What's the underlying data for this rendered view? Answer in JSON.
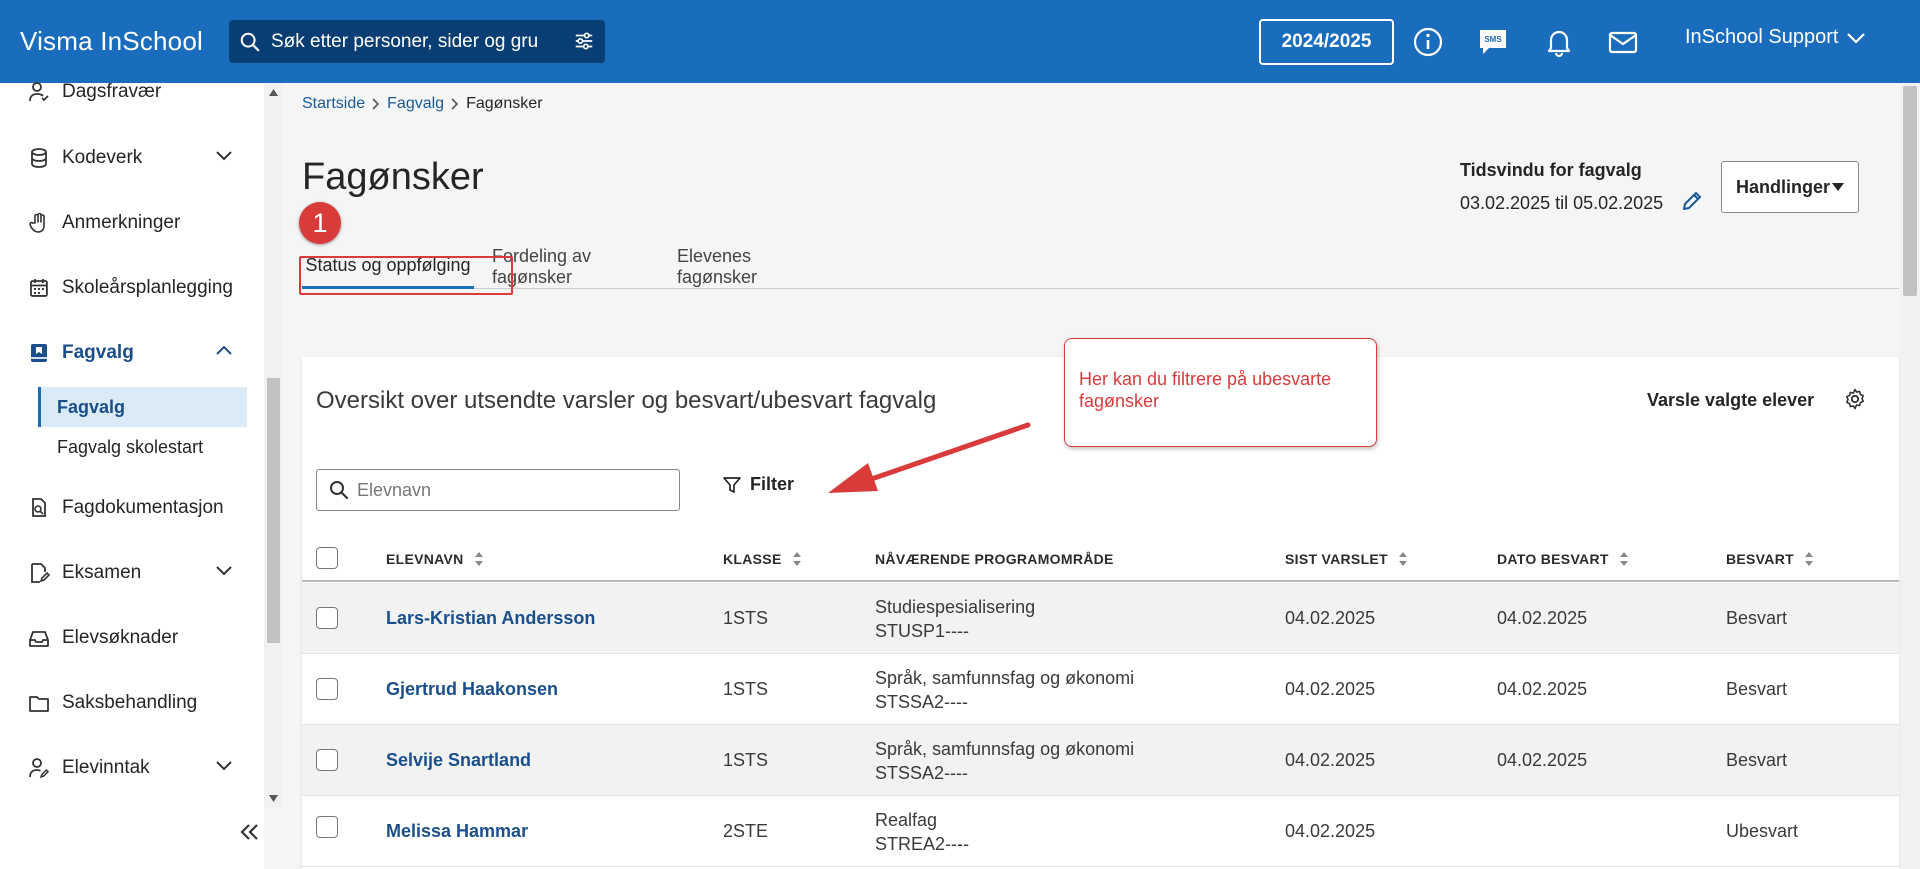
{
  "app": {
    "brand": "Visma InSchool"
  },
  "search": {
    "placeholder": "Søk etter personer, sider og gru"
  },
  "topbar": {
    "school_year": "2024/2025",
    "user": "InSchool Support"
  },
  "sidebar": {
    "items": [
      {
        "label": "Dagsfravær",
        "icon": "person-check-icon"
      },
      {
        "label": "Kodeverk",
        "icon": "database-icon",
        "expandable": true
      },
      {
        "label": "Anmerkninger",
        "icon": "hand-icon"
      },
      {
        "label": "Skoleårsplanlegging",
        "icon": "calendar-icon"
      },
      {
        "label": "Fagvalg",
        "icon": "book-bookmark-icon",
        "expanded": true,
        "active": true
      },
      {
        "label": "Fagdokumentasjon",
        "icon": "file-search-icon"
      },
      {
        "label": "Eksamen",
        "icon": "edit-document-icon",
        "expandable": true
      },
      {
        "label": "Elevsøknader",
        "icon": "inbox-icon"
      },
      {
        "label": "Saksbehandling",
        "icon": "folder-icon"
      },
      {
        "label": "Elevinntak",
        "icon": "person-edit-icon",
        "expandable": true
      }
    ],
    "subitems": [
      {
        "label": "Fagvalg",
        "active": true
      },
      {
        "label": "Fagvalg skolestart",
        "active": false
      }
    ]
  },
  "breadcrumb": {
    "items": [
      "Startside",
      "Fagvalg"
    ],
    "current": "Fagønsker"
  },
  "page": {
    "title": "Fagønsker",
    "step_badge": "1",
    "time_window_label": "Tidsvindu for fagvalg",
    "time_window_value": "03.02.2025 til 05.02.2025",
    "actions_label": "Handlinger"
  },
  "tabs": [
    {
      "label": "Status og oppfølging",
      "active": true
    },
    {
      "label": "Fordeling av fagønsker",
      "active": false
    },
    {
      "label": "Elevenes fagønsker",
      "active": false
    }
  ],
  "card": {
    "title": "Oversikt over utsendte varsler og besvart/ubesvart fagvalg",
    "notify_label": "Varsle valgte elever",
    "search_placeholder": "Elevnavn",
    "filter_label": "Filter"
  },
  "callout": {
    "text": "Her kan du filtrere på ubesvarte fagønsker"
  },
  "table": {
    "headers": [
      "ELEVNAVN",
      "KLASSE",
      "NÅVÆRENDE PROGRAMOMRÅDE",
      "SIST VARSLET",
      "DATO BESVART",
      "BESVART"
    ],
    "rows": [
      {
        "name": "Lars-Kristian Andersson",
        "class": "1STS",
        "program": "Studiespesialisering",
        "program_code": "STUSP1----",
        "last_notified": "04.02.2025",
        "answered_date": "04.02.2025",
        "status": "Besvart"
      },
      {
        "name": "Gjertrud Haakonsen",
        "class": "1STS",
        "program": "Språk, samfunnsfag og økonomi",
        "program_code": "STSSA2----",
        "last_notified": "04.02.2025",
        "answered_date": "04.02.2025",
        "status": "Besvart"
      },
      {
        "name": "Selvije Snartland",
        "class": "1STS",
        "program": "Språk, samfunnsfag og økonomi",
        "program_code": "STSSA2----",
        "last_notified": "04.02.2025",
        "answered_date": "04.02.2025",
        "status": "Besvart"
      },
      {
        "name": "Melissa Hammar",
        "class": "2STE",
        "program": "Realfag",
        "program_code": "STREA2----",
        "last_notified": "04.02.2025",
        "answered_date": "",
        "status": "Ubesvart"
      }
    ]
  },
  "colors": {
    "topbar": "#1a6dbd",
    "search_bg": "#093e74",
    "link": "#1a4f8b",
    "annotation": "#d93b3b"
  }
}
